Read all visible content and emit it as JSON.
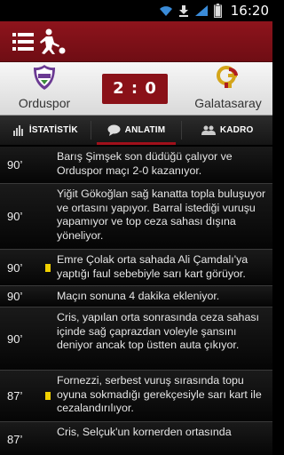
{
  "status_bar": {
    "time": "16:20"
  },
  "match": {
    "home_team": "Orduspor",
    "away_team": "Galatasaray",
    "score": "2 : 0"
  },
  "tabs": [
    {
      "label": "İSTATİSTİK",
      "icon": "bar-chart-icon",
      "active": false
    },
    {
      "label": "ANLATIM",
      "icon": "speech-bubble-icon",
      "active": true
    },
    {
      "label": "KADRO",
      "icon": "group-icon",
      "active": false
    }
  ],
  "commentary": [
    {
      "minute": "90’",
      "card": "",
      "text": "Barış Şimşek son düdüğü çalıyor ve Orduspor maçı 2-0 kazanıyor."
    },
    {
      "minute": "90’",
      "card": "",
      "text": "Yiğit Gökoğlan sağ kanatta topla buluşuyor ve ortasını yapıyor. Barral istediği vuruşu yapamıyor ve top ceza sahası dışına yöneliyor."
    },
    {
      "minute": "90’",
      "card": "yellow",
      "text": "Emre Çolak orta sahada Ali Çamdalı'ya yaptığı faul sebebiyle sarı kart görüyor."
    },
    {
      "minute": "90’",
      "card": "",
      "text": "Maçın sonuna 4 dakika ekleniyor."
    },
    {
      "minute": "90’",
      "card": "",
      "text": "Cris, yapılan orta sonrasında ceza sahası içinde sağ çaprazdan voleyle şansını deniyor ancak top üstten auta çıkıyor."
    },
    {
      "minute": "87’",
      "card": "yellow",
      "text": "Fornezzi, serbest vuruş sırasında topu oyuna sokmadığı gerekçesiyle sarı kart ile cezalandırılıyor."
    },
    {
      "minute": "87’",
      "card": "",
      "text": "Cris, Selçuk'un kornerden ortasında"
    }
  ],
  "colors": {
    "accent": "#8a1118",
    "card_yellow": "#f0d000"
  }
}
